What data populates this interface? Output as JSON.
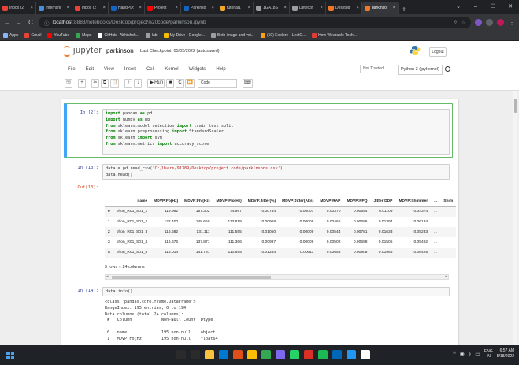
{
  "browser": {
    "tabs": [
      {
        "label": "Inbox (2",
        "fav": "#ea4335"
      },
      {
        "label": "Internshi",
        "fav": "#4a90d9"
      },
      {
        "label": "Inbox (2",
        "fav": "#ea4335"
      },
      {
        "label": "HandPD:",
        "fav": "#1565c0"
      },
      {
        "label": "Project",
        "fav": "#ff0000"
      },
      {
        "label": "Parkinso",
        "fav": "#1565c0"
      },
      {
        "label": "tutorial1",
        "fav": "#f9a825"
      },
      {
        "label": "1GA18S",
        "fav": "#9e9e9e"
      },
      {
        "label": "Detectin",
        "fav": "#9e9e9e"
      },
      {
        "label": "Desktop",
        "fav": "#f37726"
      },
      {
        "label": "parkinso",
        "fav": "#f37726"
      }
    ],
    "new_tab_label": "+",
    "window_controls": {
      "chevron": "⌄",
      "minimize": "–",
      "maximize": "☐",
      "close": "✕"
    },
    "nav": {
      "back": "←",
      "forward": "→",
      "reload": "C"
    },
    "url_host": "localhost",
    "url_path": ":8888/notebooks/Desktop/project%20code/parkinson.ipynb",
    "bookmarks": [
      {
        "label": "Apps",
        "fav": "#8ab4f8"
      },
      {
        "label": "Gmail",
        "fav": "#ea4335"
      },
      {
        "label": "YouTube",
        "fav": "#ff0000"
      },
      {
        "label": "Maps",
        "fav": "#34a853"
      },
      {
        "label": "GitHub - Abhishek...",
        "fav": "#ffffff"
      },
      {
        "label": "lab",
        "fav": "#9e9e9e"
      },
      {
        "label": "My Drive - Google...",
        "fav": "#fbbc04"
      },
      {
        "label": "Both image and voi...",
        "fav": "#9e9e9e"
      },
      {
        "label": "(10) Explore - LeetC...",
        "fav": "#ffa116"
      },
      {
        "label": "How Wearable Tech...",
        "fav": "#e53935"
      }
    ]
  },
  "jupyter": {
    "logo_text": "jupyter",
    "notebook_name": "parkinson",
    "checkpoint": "Last Checkpoint: 05/05/2022   (autosaved)",
    "logout_label": "Logout",
    "menu": [
      "File",
      "Edit",
      "View",
      "Insert",
      "Cell",
      "Kernel",
      "Widgets",
      "Help"
    ],
    "trusted_label": "Not Trusted",
    "kernel_label": "Python 3 (ipykernel)",
    "toolbar": {
      "save": "🖫",
      "add": "+",
      "cut": "✂",
      "copy": "⧉",
      "paste": "📋",
      "up": "↑",
      "down": "↓",
      "run_icon": "▶",
      "run_label": "Run",
      "stop": "■",
      "restart": "C",
      "fastforward": "⏩",
      "cell_type": "Code",
      "keyboard": "⌨"
    }
  },
  "cells": {
    "c1_prompt": "In [2]:",
    "c1_lines": [
      {
        "k1": "import",
        "t1": " pandas ",
        "k2": "as",
        "t2": " pd"
      },
      {
        "k1": "import",
        "t1": " numpy ",
        "k2": "as",
        "t2": " np"
      },
      {
        "k1": "from",
        "t1": " sklearn.model_selection ",
        "k2": "import",
        "t2": " train_test_split"
      },
      {
        "k1": "from",
        "t1": " sklearn.preprocessing ",
        "k2": "import",
        "t2": " StandardScaler"
      },
      {
        "k1": "from",
        "t1": " sklearn ",
        "k2": "import",
        "t2": " svm"
      },
      {
        "k1": "from",
        "t1": " sklearn.metrics ",
        "k2": "import",
        "t2": " accuracy_score"
      }
    ],
    "c2_prompt": "In [13]:",
    "c2_line1_a": "data = pd.read_csv(",
    "c2_line1_str": "'C:/Users/91789/Desktop/project code/parkinsons.csv'",
    "c2_line1_b": ")",
    "c2_line2": "data.head()",
    "out_prompt": "Out[13]:",
    "df_columns": [
      "",
      "name",
      "MDVP:Fo(Hz)",
      "MDVP:Fhi(Hz)",
      "MDVP:Flo(Hz)",
      "MDVP:Jitter(%)",
      "MDVP:Jitter(Abs)",
      "MDVP:RAP",
      "MDVP:PPQ",
      "Jitter:DDP",
      "MDVP:Shimmer",
      "...",
      "Shim"
    ],
    "df_rows": [
      [
        "0",
        "phon_R01_S01_1",
        "119.992",
        "157.302",
        "74.997",
        "0.00784",
        "0.00007",
        "0.00370",
        "0.00554",
        "0.01109",
        "0.04374",
        "..."
      ],
      [
        "1",
        "phon_R01_S01_2",
        "122.400",
        "148.650",
        "113.819",
        "0.00968",
        "0.00008",
        "0.00465",
        "0.00696",
        "0.01394",
        "0.06134",
        "..."
      ],
      [
        "2",
        "phon_R01_S01_3",
        "116.682",
        "131.111",
        "111.555",
        "0.01050",
        "0.00009",
        "0.00544",
        "0.00781",
        "0.01633",
        "0.05233",
        "..."
      ],
      [
        "3",
        "phon_R01_S01_4",
        "116.676",
        "137.871",
        "111.366",
        "0.00997",
        "0.00009",
        "0.00502",
        "0.00698",
        "0.01505",
        "0.05492",
        "..."
      ],
      [
        "4",
        "phon_R01_S01_5",
        "116.014",
        "141.781",
        "110.655",
        "0.01284",
        "0.00011",
        "0.00655",
        "0.00908",
        "0.01966",
        "0.06425",
        "..."
      ]
    ],
    "df_shape": "5 rows × 24 columns",
    "c3_prompt": "In [14]:",
    "c3_code": "data.info()",
    "c3_output": [
      "<class 'pandas.core.frame.DataFrame'>",
      "RangeIndex: 195 entries, 0 to 194",
      "Data columns (total 24 columns):",
      " #   Column            Non-Null Count  Dtype  ",
      "---  ------            --------------  -----  ",
      " 0   name              195 non-null    object ",
      " 1   MDVP:Fo(Hz)       195 non-null    float64"
    ]
  },
  "taskbar": {
    "apps": [
      "#2b2b2b",
      "#2b2b2b",
      "#f9c23c",
      "#0078d4",
      "#e04f1a",
      "#fbbc04",
      "#34a853",
      "#7b68ee",
      "#25d366",
      "#d93025",
      "#1db954",
      "#0067b8",
      "#2196f3",
      "#ffffff"
    ],
    "tray_caret": "^",
    "tray_network": "◉",
    "tray_volume": "♪",
    "tray_battery": "▭",
    "lang_top": "ENG",
    "lang_bottom": "IN",
    "time": "6:57 AM",
    "date": "5/18/2022"
  },
  "colors": {
    "jupyter_orange": "#f37726",
    "code_keyword": "#008000",
    "code_string": "#ba2121",
    "in_prompt": "#303f9f",
    "out_prompt": "#d84315"
  }
}
